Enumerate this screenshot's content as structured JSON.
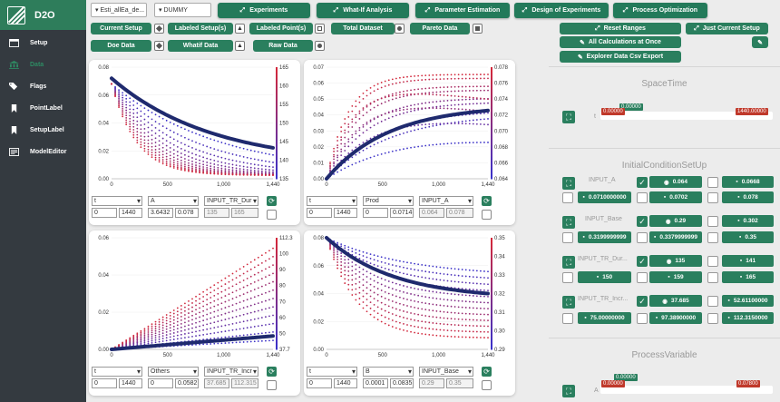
{
  "app": {
    "title": "D2O"
  },
  "sidebar": {
    "items": [
      {
        "id": "setup",
        "label": "Setup",
        "icon": "window-icon"
      },
      {
        "id": "data",
        "label": "Data",
        "icon": "bank-icon",
        "active": true
      },
      {
        "id": "flags",
        "label": "Flags",
        "icon": "tags-icon"
      },
      {
        "id": "pointlabel",
        "label": "PointLabel",
        "icon": "bookmark-icon"
      },
      {
        "id": "setuplabel",
        "label": "SetupLabel",
        "icon": "bookmark-icon"
      },
      {
        "id": "modeleditor",
        "label": "ModelEditor",
        "icon": "editor-icon"
      }
    ]
  },
  "toolbar": {
    "model_select": "Esti_allEa_de...",
    "data_select": "DUMMY",
    "tabs": [
      "Experiments",
      "What-If Analysis",
      "Parameter Estimation",
      "Design of Experiments",
      "Process Optimization"
    ],
    "row2": {
      "current_setup": "Current Setup",
      "labeled_setups": "Labeled Setup(s)",
      "labeled_points": "Labeled Point(s)",
      "total_dataset": "Total Dataset",
      "pareto_data": "Pareto Data"
    },
    "row3": {
      "doe_data": "Doe Data",
      "whatif_data": "Whatif Data",
      "raw_data": "Raw Data"
    }
  },
  "charts": [
    {
      "id": "chart-a",
      "x_select": "t",
      "y_select": "A",
      "color_select": "INPUT_TR_Dur",
      "x_min": "0",
      "x_max": "1440",
      "y_min": "3.6432",
      "y_max": "0.078",
      "c_min": "135",
      "c_max": "165",
      "y_ticks": [
        "0.08",
        "0.06",
        "0.04",
        "0.02",
        "0.00"
      ],
      "x_ticks": [
        "0",
        "500",
        "1,000",
        "1,440"
      ],
      "c_ticks": [
        "165",
        "160",
        "155",
        "150",
        "145",
        "140",
        "135"
      ]
    },
    {
      "id": "chart-prod",
      "x_select": "t",
      "y_select": "Prod",
      "color_select": "INPUT_A",
      "x_min": "0",
      "x_max": "1440",
      "y_min": "0",
      "y_max": "0.0714",
      "c_min": "0.064",
      "c_max": "0.078",
      "y_ticks": [
        "0.07",
        "0.06",
        "0.05",
        "0.04",
        "0.03",
        "0.02",
        "0.01",
        "0.00"
      ],
      "x_ticks": [
        "0",
        "500",
        "1,000",
        "1,440"
      ],
      "c_ticks": [
        "0.078",
        "0.076",
        "0.074",
        "0.072",
        "0.070",
        "0.068",
        "0.066",
        "0.064"
      ]
    },
    {
      "id": "chart-others",
      "x_select": "t",
      "y_select": "Others",
      "color_select": "INPUT_TR_Incr",
      "x_min": "0",
      "x_max": "1440",
      "y_min": "0",
      "y_max": "0.0582",
      "c_min": "37.685",
      "c_max": "112.315",
      "y_ticks": [
        "0.06",
        "0.04",
        "0.02",
        "0.00"
      ],
      "x_ticks": [
        "0",
        "500",
        "1,000",
        "1,440"
      ],
      "c_ticks": [
        "112.3",
        "100",
        "90",
        "80",
        "70",
        "60",
        "50",
        "37.7"
      ]
    },
    {
      "id": "chart-b",
      "x_select": "t",
      "y_select": "B",
      "color_select": "INPUT_Base",
      "x_min": "0",
      "x_max": "1440",
      "y_min": "0.0001",
      "y_max": "0.0835",
      "c_min": "0.29",
      "c_max": "0.35",
      "y_ticks": [
        "0.08",
        "0.06",
        "0.04",
        "0.02",
        "0.00"
      ],
      "x_ticks": [
        "0",
        "500",
        "1,000",
        "1,440"
      ],
      "c_ticks": [
        "0.35",
        "0.34",
        "0.33",
        "0.32",
        "0.31",
        "0.30",
        "0.29"
      ]
    }
  ],
  "right": {
    "reset_ranges": "Reset Ranges",
    "just_current": "Just Current Setup",
    "all_calc": "All Calculations at Once",
    "explorer": "Explorer Data Csv Export",
    "spacetime": {
      "title": "SpaceTime",
      "var": "t",
      "min": "0.00000",
      "max": "1440.00000",
      "current": "0.00000"
    },
    "initial": {
      "title": "InitialConditionSetUp",
      "params": [
        {
          "name": "INPUT_A",
          "v1": "0.0710000000",
          "v2": "0.064",
          "v3": "0.0668",
          "v4": "0.0702",
          "v5": "0.078"
        },
        {
          "name": "INPUT_Base",
          "v1": "0.3199999999",
          "v2": "0.29",
          "v3": "0.302",
          "v4": "0.3379999999",
          "v5": "0.35"
        },
        {
          "name": "INPUT_TR_Dur...",
          "v1": "150",
          "v2": "135",
          "v3": "141",
          "v4": "159",
          "v5": "165"
        },
        {
          "name": "INPUT_TR_Incr...",
          "v1": "75.00000000",
          "v2": "37.685",
          "v3": "52.61100000",
          "v4": "97.38900000",
          "v5": "112.3150000"
        }
      ]
    },
    "process": {
      "title": "ProcessVariable",
      "var": "A",
      "min": "0.00000",
      "max": "0.07800",
      "current": "0.00000"
    }
  }
}
